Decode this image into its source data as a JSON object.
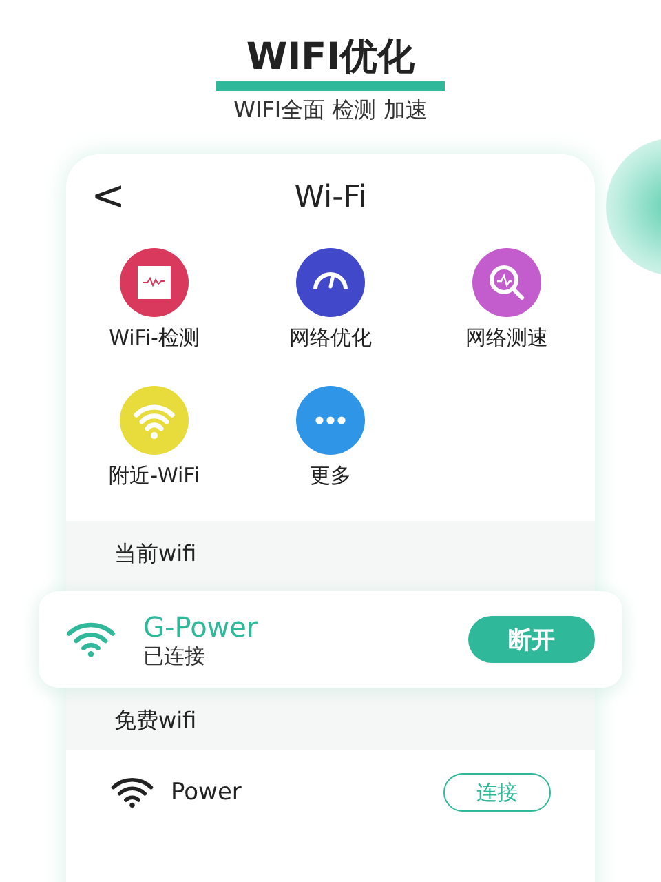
{
  "header": {
    "title": "WIFI优化",
    "subtitle": "WIFI全面 检测 加速"
  },
  "nav": {
    "back": "<",
    "title": "Wi-Fi"
  },
  "features": [
    {
      "label": "WiFi-检测",
      "kind": "monitor",
      "color": "#d9395d"
    },
    {
      "label": "网络优化",
      "kind": "gauge",
      "color": "#4148c9"
    },
    {
      "label": "网络测速",
      "kind": "search",
      "color": "#c35ccc"
    },
    {
      "label": "附近-WiFi",
      "kind": "wifi",
      "color": "#e8dc3c"
    },
    {
      "label": "更多",
      "kind": "more",
      "color": "#2f95e6"
    }
  ],
  "current": {
    "heading": "当前wifi",
    "name": "G-Power",
    "status": "已连接",
    "button": "断开"
  },
  "free": {
    "heading": "免费wifi",
    "networks": [
      {
        "name": "Power",
        "button": "连接"
      }
    ]
  }
}
